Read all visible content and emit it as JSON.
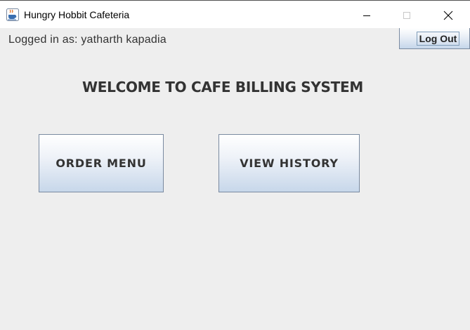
{
  "window": {
    "title": "Hungry Hobbit Cafeteria",
    "icon": "java-coffee-cup-icon"
  },
  "header": {
    "logged_in_text": "Logged in as: yatharth kapadia",
    "logout_label": "Log Out"
  },
  "main": {
    "welcome_text": "WELCOME TO CAFE BILLING SYSTEM",
    "order_menu_label": "ORDER MENU",
    "view_history_label": "VIEW HISTORY"
  },
  "colors": {
    "background": "#eeeeee",
    "button_gradient_bottom": "#c7d7ea",
    "button_border": "#7a8aa0",
    "text": "#333333"
  }
}
